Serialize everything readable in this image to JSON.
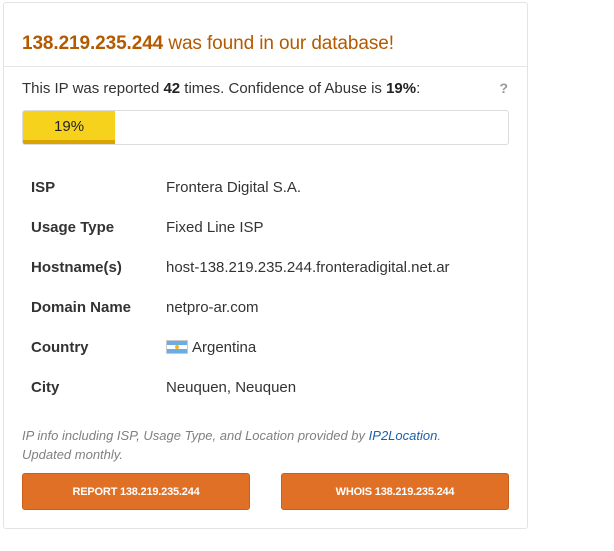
{
  "header": {
    "ip": "138.219.235.244",
    "found_text": " was found in our database!"
  },
  "report": {
    "prefix": "This IP was reported ",
    "count": "42",
    "middle": " times. Confidence of Abuse is ",
    "confidence": "19%",
    "suffix": ":",
    "help": "?"
  },
  "progress": {
    "label": "19%",
    "value_fraction": 0.19,
    "color": "#f7d21d"
  },
  "details": {
    "isp_label": "ISP",
    "isp_value": "Frontera Digital S.A.",
    "usage_label": "Usage Type",
    "usage_value": "Fixed Line ISP",
    "hostname_label": "Hostname(s)",
    "hostname_value": "host-138.219.235.244.fronteradigital.net.ar",
    "domain_label": "Domain Name",
    "domain_value": "netpro-ar.com",
    "country_label": "Country",
    "country_value": "Argentina",
    "country_flag_icon": "argentina-flag-icon",
    "city_label": "City",
    "city_value": "Neuquen, Neuquen"
  },
  "note": {
    "text": "IP info including ISP, Usage Type, and Location provided by ",
    "link": "IP2Location",
    "after_link": ".",
    "updated": "Updated monthly."
  },
  "buttons": {
    "report_label": "REPORT 138.219.235.244",
    "whois_label": "WHOIS 138.219.235.244"
  },
  "colors": {
    "accent_orange": "#e07026",
    "header_text": "#b35900",
    "link_blue": "#1f5fa8"
  }
}
